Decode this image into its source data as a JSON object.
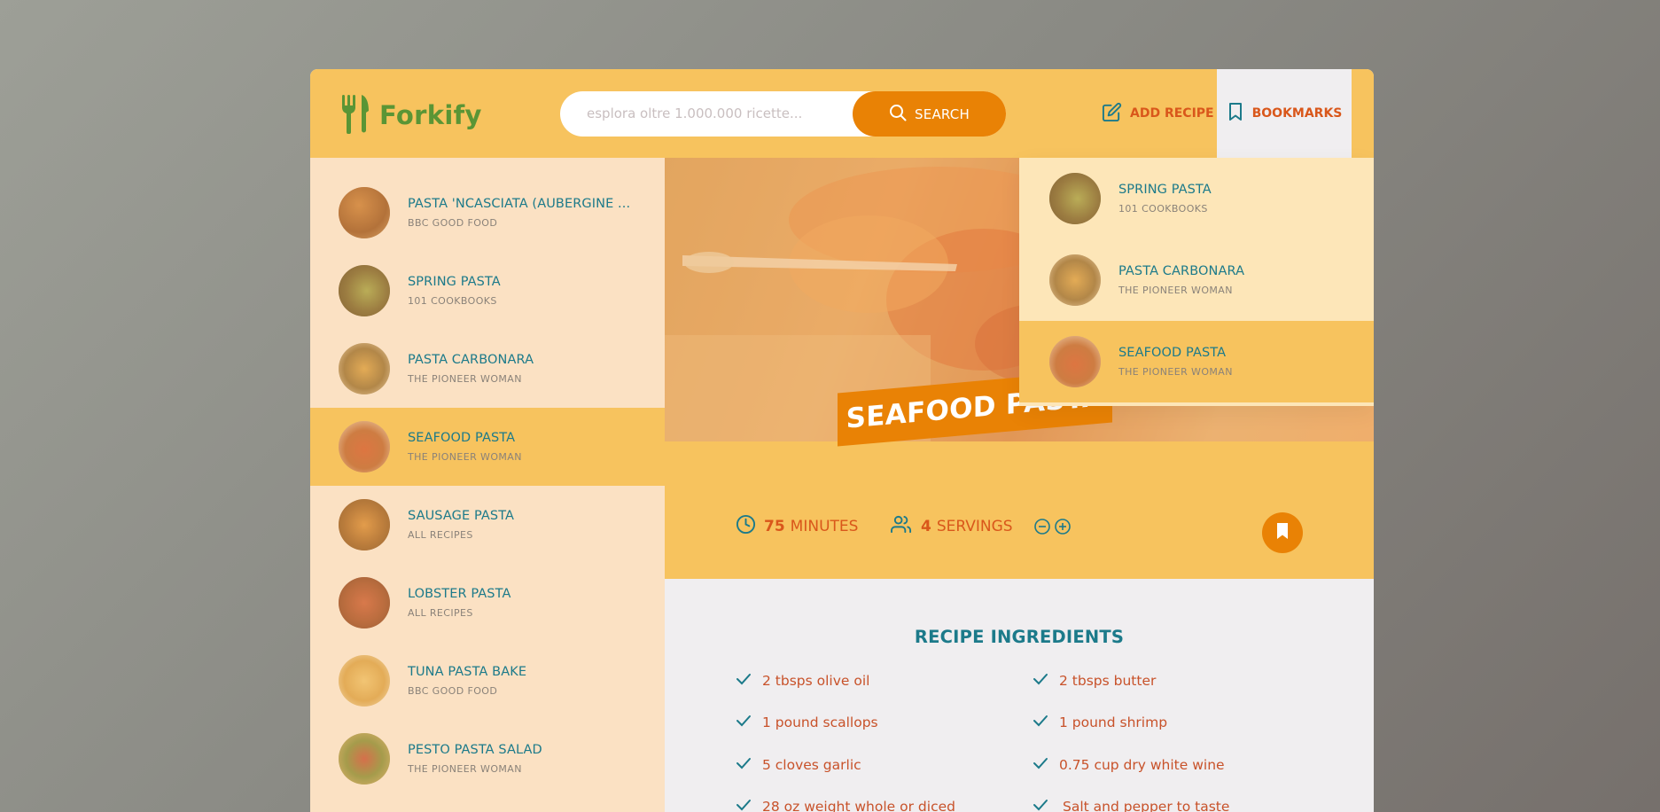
{
  "header": {
    "logo_text": "Forkify",
    "search_placeholder": "esplora oltre 1.000.000 ricette...",
    "search_label": "SEARCH",
    "add_recipe_label": "ADD RECIPE",
    "bookmarks_label": "BOOKMARKS"
  },
  "results": [
    {
      "title": "PASTA 'NCASCIATA (AUBERGINE ...",
      "publisher": "BBC GOOD FOOD"
    },
    {
      "title": "SPRING PASTA",
      "publisher": "101 COOKBOOKS"
    },
    {
      "title": "PASTA CARBONARA",
      "publisher": "THE PIONEER WOMAN"
    },
    {
      "title": "SEAFOOD PASTA",
      "publisher": "THE PIONEER WOMAN"
    },
    {
      "title": "SAUSAGE PASTA",
      "publisher": "ALL RECIPES"
    },
    {
      "title": "LOBSTER PASTA",
      "publisher": "ALL RECIPES"
    },
    {
      "title": "TUNA PASTA BAKE",
      "publisher": "BBC GOOD FOOD"
    },
    {
      "title": "PESTO PASTA SALAD",
      "publisher": "THE PIONEER WOMAN"
    }
  ],
  "bookmarks": [
    {
      "title": "SPRING PASTA",
      "publisher": "101 COOKBOOKS"
    },
    {
      "title": "PASTA CARBONARA",
      "publisher": "THE PIONEER WOMAN"
    },
    {
      "title": "SEAFOOD PASTA",
      "publisher": "THE PIONEER WOMAN"
    }
  ],
  "recipe": {
    "title": "SEAFOOD PASTA",
    "minutes": "75",
    "minutes_label": "MINUTES",
    "servings": "4",
    "servings_label": "SERVINGS",
    "ingredients_heading": "RECIPE INGREDIENTS",
    "ingredients": [
      "2 tbsps olive oil",
      "2 tbsps butter",
      "1 pound scallops",
      "1 pound shrimp",
      "5 cloves garlic",
      "0.75 cup dry white wine",
      "28 oz weight whole or diced",
      "Salt and pepper to taste"
    ]
  },
  "colors": {
    "accent": "#e98205",
    "header_bg": "#f7c35e",
    "sidebar_bg": "#fbe1c3",
    "title_teal": "#1c7a8a",
    "text_orange": "#d9571b",
    "logo_green": "#5a9535"
  },
  "icons": {
    "logo": "fork-knife-icon",
    "search": "search-icon",
    "add_recipe": "edit-icon",
    "bookmarks": "bookmark-icon",
    "minutes": "clock-icon",
    "servings": "users-icon",
    "decrease": "minus-circle-icon",
    "increase": "plus-circle-icon",
    "ingredient": "check-icon"
  }
}
